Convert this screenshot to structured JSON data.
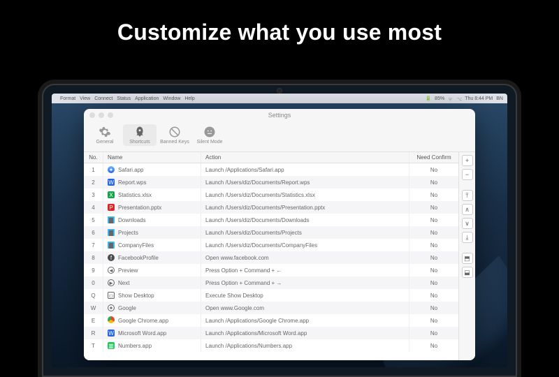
{
  "hero": {
    "title": "Customize what you use most"
  },
  "menubar": {
    "left": [
      "",
      "Format",
      "View",
      "Connect",
      "Status",
      "Application",
      "Window",
      "Help"
    ],
    "right": {
      "battery": "85%",
      "time": "Thu 8:44 PM",
      "user": "BN"
    }
  },
  "window": {
    "title": "Settings",
    "tabs": [
      {
        "id": "general",
        "label": "General",
        "icon": "gear-icon"
      },
      {
        "id": "shortcuts",
        "label": "Shortcuts",
        "icon": "rocket-icon",
        "active": true
      },
      {
        "id": "banned",
        "label": "Banned Keys",
        "icon": "ban-icon"
      },
      {
        "id": "silent",
        "label": "Silent Mode",
        "icon": "face-icon"
      }
    ],
    "columns": {
      "no": "No.",
      "name": "Name",
      "action": "Action",
      "confirm": "Need Confirm"
    },
    "rows": [
      {
        "no": "1",
        "icon": "safari",
        "color": "#3b82f6",
        "name": "Safari.app",
        "action": "Launch /Applications/Safari.app",
        "confirm": "No"
      },
      {
        "no": "2",
        "icon": "doc",
        "color": "#2563eb",
        "name": "Report.wps",
        "action": "Launch /Users/diz/Documents/Report.wps",
        "confirm": "No"
      },
      {
        "no": "3",
        "icon": "xls",
        "color": "#16a34a",
        "name": "Statistics.xlsx",
        "action": "Launch /Users/diz/Documents/Statistics.xlsx",
        "confirm": "No"
      },
      {
        "no": "4",
        "icon": "ppt",
        "color": "#dc2626",
        "name": "Presentation.pptx",
        "action": "Launch /Users/diz/Documents/Presentation.pptx",
        "confirm": "No"
      },
      {
        "no": "5",
        "icon": "folder",
        "color": "#38bdf8",
        "name": "Downloads",
        "action": "Launch /Users/diz/Documents/Downloads",
        "confirm": "No"
      },
      {
        "no": "6",
        "icon": "folder",
        "color": "#38bdf8",
        "name": "Projects",
        "action": "Launch /Users/diz/Documents/Projects",
        "confirm": "No"
      },
      {
        "no": "7",
        "icon": "folder",
        "color": "#38bdf8",
        "name": "CompanyFiles",
        "action": "Launch /Users/diz/Documents/CompanyFiles",
        "confirm": "No"
      },
      {
        "no": "8",
        "icon": "fb",
        "color": "#4b4b4b",
        "name": "FacebookProfile",
        "action": "Open www.facebook.com",
        "confirm": "No"
      },
      {
        "no": "9",
        "icon": "prev",
        "color": "#4b4b4b",
        "name": "Preview",
        "action": "Press Option + Command + ←",
        "confirm": "No"
      },
      {
        "no": "0",
        "icon": "next",
        "color": "#4b4b4b",
        "name": "Next",
        "action": "Press Option + Command + →",
        "confirm": "No"
      },
      {
        "no": "Q",
        "icon": "display",
        "color": "#4b4b4b",
        "name": "Show Desktop",
        "action": "Execute Show Desktop",
        "confirm": "No"
      },
      {
        "no": "W",
        "icon": "globe",
        "color": "#4b4b4b",
        "name": "Google",
        "action": "Open www.Google.com",
        "confirm": "No"
      },
      {
        "no": "E",
        "icon": "chrome",
        "color": "#ea4335",
        "name": "Google Chrome.app",
        "action": "Launch /Applications/Google Chrome.app",
        "confirm": "No"
      },
      {
        "no": "R",
        "icon": "word",
        "color": "#2563eb",
        "name": "Microsoft Word.app",
        "action": "Launch /Applications/Microsoft Word.app",
        "confirm": "No"
      },
      {
        "no": "T",
        "icon": "numbers",
        "color": "#22c55e",
        "name": "Numbers.app",
        "action": "Launch /Applications/Numbers.app",
        "confirm": "No"
      }
    ],
    "sideButtons": [
      {
        "id": "add",
        "glyph": "+"
      },
      {
        "id": "remove",
        "glyph": "−"
      },
      {
        "id": "top",
        "glyph": "⤒"
      },
      {
        "id": "up",
        "glyph": "∧"
      },
      {
        "id": "down",
        "glyph": "∨"
      },
      {
        "id": "bottom",
        "glyph": "⤓"
      },
      {
        "id": "import",
        "glyph": "⬒"
      },
      {
        "id": "export",
        "glyph": "⬓"
      }
    ]
  }
}
